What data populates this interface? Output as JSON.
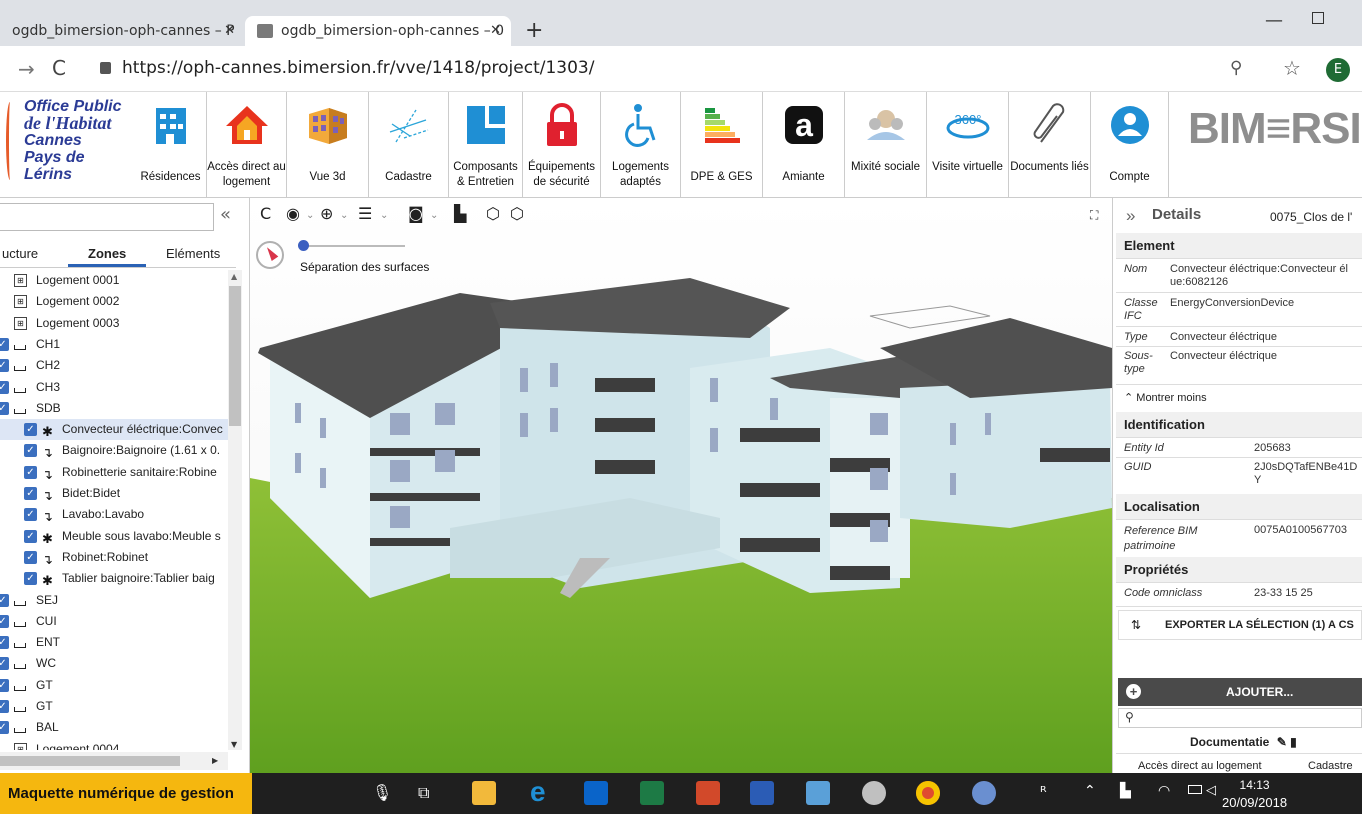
{
  "browser": {
    "tabs": [
      {
        "title": "ogdb_bimersion-oph-cannes – P"
      },
      {
        "title": "ogdb_bimersion-oph-cannes – 0"
      }
    ],
    "close_glyph": "✕",
    "new_tab": "+",
    "url": "https://oph-cannes.bimersion.fr/vve/1418/project/1303/",
    "profile_initial": "E"
  },
  "logo": {
    "lines": [
      "Office Public",
      "de l'Habitat",
      "Cannes",
      "Pays de Lérins"
    ]
  },
  "toolbar": {
    "items": [
      {
        "label": "Résidences",
        "icon": "building-icon"
      },
      {
        "label": "Accès direct au logement",
        "icon": "house-icon"
      },
      {
        "label": "Vue 3d",
        "icon": "facade-3d-icon"
      },
      {
        "label": "Cadastre",
        "icon": "cadastre-map-icon"
      },
      {
        "label": "Composants & Entretien",
        "icon": "components-icon"
      },
      {
        "label": "Équipements de sécurité",
        "icon": "lock-icon"
      },
      {
        "label": "Logements adaptés",
        "icon": "accessibility-icon"
      },
      {
        "label": "DPE & GES",
        "icon": "energy-label-icon"
      },
      {
        "label": "Amiante",
        "icon": "asbestos-icon"
      },
      {
        "label": "Mixité sociale",
        "icon": "people-icon"
      },
      {
        "label": "Visite virtuelle",
        "icon": "360-icon"
      },
      {
        "label": "Documents liés",
        "icon": "paperclip-icon"
      },
      {
        "label": "Compte",
        "icon": "user-icon"
      }
    ],
    "brand": "BIM≡RSI"
  },
  "left_panel": {
    "collapse": "«",
    "tabs": [
      "ucture",
      "Zones",
      "Eléments"
    ],
    "active_tab": "Zones",
    "tree": [
      {
        "level": 0,
        "label": "Logement 0001"
      },
      {
        "level": 0,
        "label": "Logement 0002"
      },
      {
        "level": 0,
        "label": "Logement 0003"
      },
      {
        "level": 1,
        "label": "CH1"
      },
      {
        "level": 1,
        "label": "CH2"
      },
      {
        "level": 1,
        "label": "CH3"
      },
      {
        "level": 1,
        "label": "SDB"
      },
      {
        "level": 2,
        "label": "Convecteur éléctrique:Convec",
        "icon": "puzzle-icon",
        "selected": true
      },
      {
        "level": 2,
        "label": "Baignoire:Baignoire (1.61 x 0.",
        "icon": "faucet-icon"
      },
      {
        "level": 2,
        "label": "Robinetterie sanitaire:Robine",
        "icon": "faucet-icon"
      },
      {
        "level": 2,
        "label": "Bidet:Bidet",
        "icon": "faucet-icon"
      },
      {
        "level": 2,
        "label": "Lavabo:Lavabo",
        "icon": "faucet-icon"
      },
      {
        "level": 2,
        "label": "Meuble sous lavabo:Meuble s",
        "icon": "puzzle-icon"
      },
      {
        "level": 2,
        "label": "Robinet:Robinet",
        "icon": "faucet-icon"
      },
      {
        "level": 2,
        "label": "Tablier baignoire:Tablier baig",
        "icon": "puzzle-icon"
      },
      {
        "level": 1,
        "label": "SEJ"
      },
      {
        "level": 1,
        "label": "CUI"
      },
      {
        "level": 1,
        "label": "ENT"
      },
      {
        "level": 1,
        "label": "WC"
      },
      {
        "level": 1,
        "label": "GT"
      },
      {
        "level": 1,
        "label": "GT"
      },
      {
        "level": 1,
        "label": "BAL"
      },
      {
        "level": 0,
        "label": "Logement 0004"
      }
    ]
  },
  "viewer": {
    "toolbar_glyphs": [
      "C",
      "◉",
      "⌄",
      "⊕",
      "⌄",
      "☰",
      "⌄",
      "◙",
      "⌄",
      "▙",
      "⬡",
      "⬡"
    ],
    "separation_label": "Séparation des surfaces",
    "fullscreen": "⛶"
  },
  "right_panel": {
    "expand": "»",
    "title": "Details",
    "subtitle": "0075_Clos de l'",
    "element_header": "Element",
    "element_fields": [
      {
        "label": "Nom",
        "value": "Convecteur éléctrique:Convecteur él ue:6082126"
      },
      {
        "label": "Classe IFC",
        "value": "EnergyConversionDevice"
      },
      {
        "label": "Type",
        "value": "Convecteur éléctrique"
      },
      {
        "label": "Sous-type",
        "value": "Convecteur éléctrique"
      }
    ],
    "show_less": "Montrer moins",
    "identification_header": "Identification",
    "identification_fields": [
      {
        "label": "Entity Id",
        "value": "205683"
      },
      {
        "label": "GUID",
        "value": "2J0sDQTafENBe41D Y"
      }
    ],
    "localisation_header": "Localisation",
    "localisation_fields": [
      {
        "label": "Reference BIM patrimoine",
        "value": "0075A0100567703"
      }
    ],
    "proprietes_header": "Propriétés",
    "proprietes_fields": [
      {
        "label": "Code omniclass",
        "value": "23-33 15 25"
      }
    ],
    "export_label": "EXPORTER LA SÉLECTION (1) A CS",
    "add_label": "AJOUTER...",
    "documentatie": "Documentatie",
    "bottom_tabs": [
      "Accès direct au logement",
      "Cadastre"
    ]
  },
  "taskbar": {
    "caption": "Maquette numérique de gestion",
    "time": "14:13",
    "date": "20/09/2018"
  }
}
